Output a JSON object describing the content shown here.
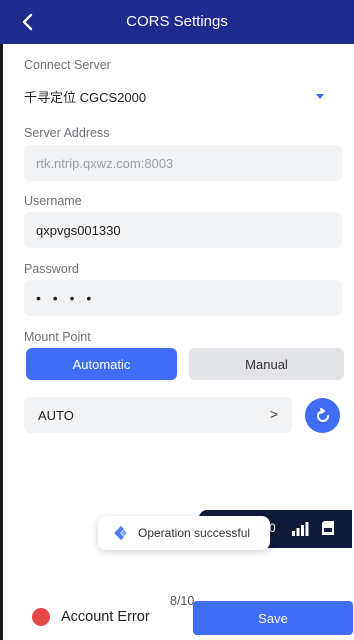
{
  "header": {
    "title": "CORS Settings",
    "back_icon": "chevron-left-icon"
  },
  "connect_server": {
    "label": "Connect Server",
    "value": "千寻定位 CGCS2000"
  },
  "server_address": {
    "label": "Server Address",
    "placeholder": "rtk.ntrip.qxwz.com:8003"
  },
  "username": {
    "label": "Username",
    "value": "qxpvgs001330"
  },
  "password": {
    "label": "Password",
    "value": "• • • •"
  },
  "mount_point": {
    "label": "Mount Point",
    "options": [
      "Automatic",
      "Manual"
    ],
    "selected": "Automatic",
    "value": "AUTO",
    "chevron": ">"
  },
  "status_overlay": {
    "count_text": "0"
  },
  "toast": {
    "message": "Operation successful"
  },
  "footer": {
    "pager": "8/10",
    "account_status": "Account Error",
    "save_label": "Save"
  },
  "colors": {
    "header_bg": "#1d2b8c",
    "accent": "#3f6df5",
    "error": "#e8494a"
  }
}
